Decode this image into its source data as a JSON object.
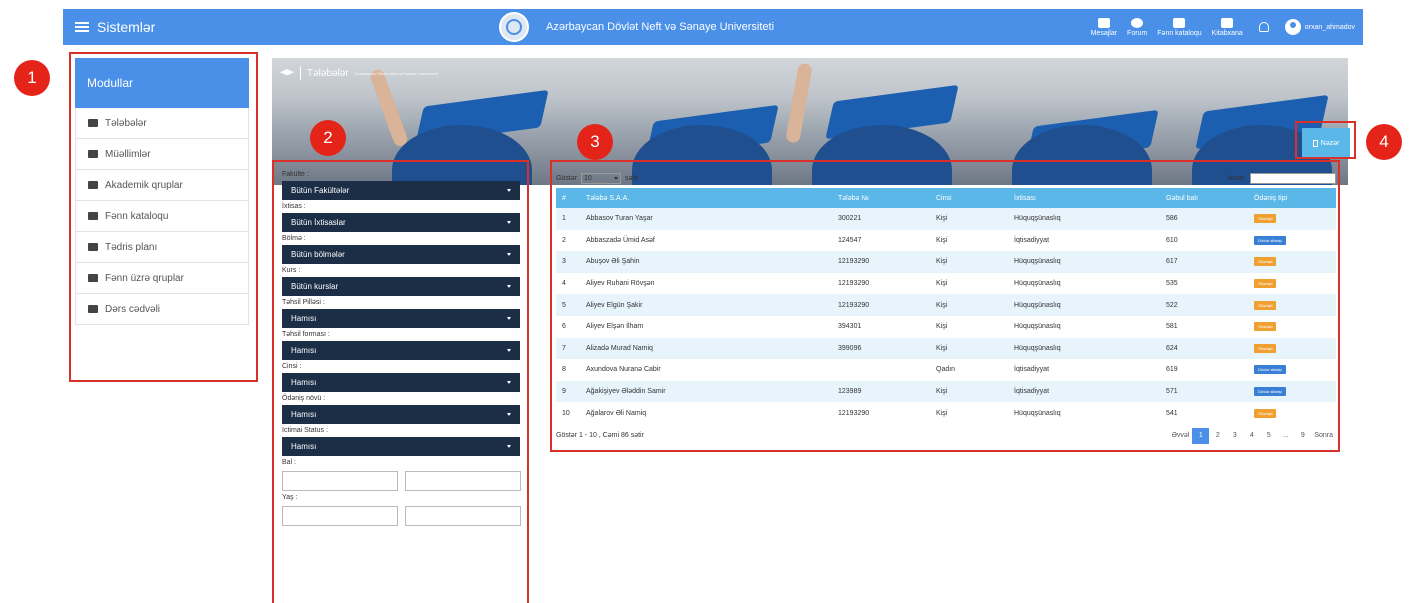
{
  "header": {
    "title": "Sistemlər",
    "university": "Azərbaycan Dövlət Neft və Sənaye Universiteti",
    "nav": [
      {
        "label": "Mesajlar",
        "icon": "envelope-icon"
      },
      {
        "label": "Forum",
        "icon": "chat-icon"
      },
      {
        "label": "Fənn kataloqu",
        "icon": "book-icon"
      },
      {
        "label": "Kitabxana",
        "icon": "library-icon"
      }
    ],
    "user": "orxan_ahmadov"
  },
  "callouts": [
    "1",
    "2",
    "3",
    "4"
  ],
  "sidebar": {
    "heading": "Modullar",
    "items": [
      {
        "label": "Tələbələr",
        "icon": "graduation-cap-icon"
      },
      {
        "label": "Müəllimlər",
        "icon": "user-icon"
      },
      {
        "label": "Akademik qruplar",
        "icon": "group-icon"
      },
      {
        "label": "Fənn kataloqu",
        "icon": "laptop-icon"
      },
      {
        "label": "Tədris planı",
        "icon": "bookmark-icon"
      },
      {
        "label": "Fənn üzrə qruplar",
        "icon": "file-icon"
      },
      {
        "label": "Dərs cədvəli",
        "icon": "calendar-icon"
      }
    ]
  },
  "banner": {
    "title": "Tələbələr",
    "subtitle": "Azərbaycan Dövlət Neft və Sənaye Universiteti",
    "button": "Nəzər"
  },
  "filters": [
    {
      "label": "Fakülte :",
      "value": "Bütün Fakültələr"
    },
    {
      "label": "İxtisas :",
      "value": "Bütün İxtisaslar"
    },
    {
      "label": "Bölmə :",
      "value": "Bütün bölmələr"
    },
    {
      "label": "Kurs :",
      "value": "Bütün kurslar"
    },
    {
      "label": "Təhsil Pilləsi :",
      "value": "Hamısı"
    },
    {
      "label": "Təhsil forması :",
      "value": "Hamısı"
    },
    {
      "label": "Cinsi :",
      "value": "Hamısı"
    },
    {
      "label": "Ödəniş növü :",
      "value": "Hamısı"
    },
    {
      "label": "İctimai Status :",
      "value": "Hamısı"
    }
  ],
  "range_filters": [
    {
      "label": "Bal :"
    },
    {
      "label": "Yaş :"
    }
  ],
  "table": {
    "show_label": "Göstər",
    "page_length": "10",
    "rows_label": "sətir",
    "search_label": "Axtar:",
    "columns": [
      "#",
      "Tələbə S.A.A.",
      "Tələbə №",
      "Cinsi",
      "İxtisası",
      "Gəbul balı",
      "Ödəniş tipi"
    ],
    "rows": [
      {
        "n": "1",
        "name": "Abbasov Turan Yaşar",
        "id": "300221",
        "gender": "Kişi",
        "major": "Hüquqşünaslıq",
        "score": "586",
        "payment": "Ödənişli",
        "payment_type": "paid"
      },
      {
        "n": "2",
        "name": "Abbaszadə Ümid Asəf",
        "id": "124547",
        "gender": "Kişi",
        "major": "İqtisadiyyat",
        "score": "610",
        "payment": "Dövlət sifarişi",
        "payment_type": "state"
      },
      {
        "n": "3",
        "name": "Abuşov Əli Şahin",
        "id": "12193290",
        "gender": "Kişi",
        "major": "Hüquqşünaslıq",
        "score": "617",
        "payment": "Ödənişli",
        "payment_type": "paid"
      },
      {
        "n": "4",
        "name": "Aliyev Ruhani Rövşən",
        "id": "12193290",
        "gender": "Kişi",
        "major": "Hüquqşünaslıq",
        "score": "535",
        "payment": "Ödənişli",
        "payment_type": "paid"
      },
      {
        "n": "5",
        "name": "Aliyev Elgün Şakir",
        "id": "12193290",
        "gender": "Kişi",
        "major": "Hüquqşünaslıq",
        "score": "522",
        "payment": "Ödənişli",
        "payment_type": "paid"
      },
      {
        "n": "6",
        "name": "Aliyev Elşən İlham",
        "id": "394301",
        "gender": "Kişi",
        "major": "Hüquqşünaslıq",
        "score": "581",
        "payment": "Ödənişli",
        "payment_type": "paid"
      },
      {
        "n": "7",
        "name": "Alizadə Murad Namiq",
        "id": "399096",
        "gender": "Kişi",
        "major": "Hüquqşünaslıq",
        "score": "624",
        "payment": "Ödənişli",
        "payment_type": "paid"
      },
      {
        "n": "8",
        "name": "Axundova Nuranə Cabir",
        "id": "",
        "gender": "Qadın",
        "major": "İqtisadiyyat",
        "score": "619",
        "payment": "Dövlət sifarişi",
        "payment_type": "state"
      },
      {
        "n": "9",
        "name": "Ağakişiyev Ələddin Samir",
        "id": "123989",
        "gender": "Kişi",
        "major": "İqtisadiyyat",
        "score": "571",
        "payment": "Dövlət sifarişi",
        "payment_type": "state"
      },
      {
        "n": "10",
        "name": "Ağalarov Əli Namiq",
        "id": "12193290",
        "gender": "Kişi",
        "major": "Hüquqşünaslıq",
        "score": "541",
        "payment": "Ödənişli",
        "payment_type": "paid"
      }
    ],
    "summary": "Göstər 1 - 10 , Cəmi 86 sətir",
    "pager": {
      "prev": "Əvvəl",
      "pages": [
        "1",
        "2",
        "3",
        "4",
        "5",
        "...",
        "9"
      ],
      "active": "1",
      "next": "Sonra"
    }
  },
  "colors": {
    "topbar": "#4a8fe8",
    "table_header": "#5bb7e8",
    "filter_select": "#1c2e45",
    "callout": "#e42419",
    "highlight_box": "#d9302a",
    "badge_paid": "#f0a030",
    "badge_state": "#3a7fd6"
  }
}
